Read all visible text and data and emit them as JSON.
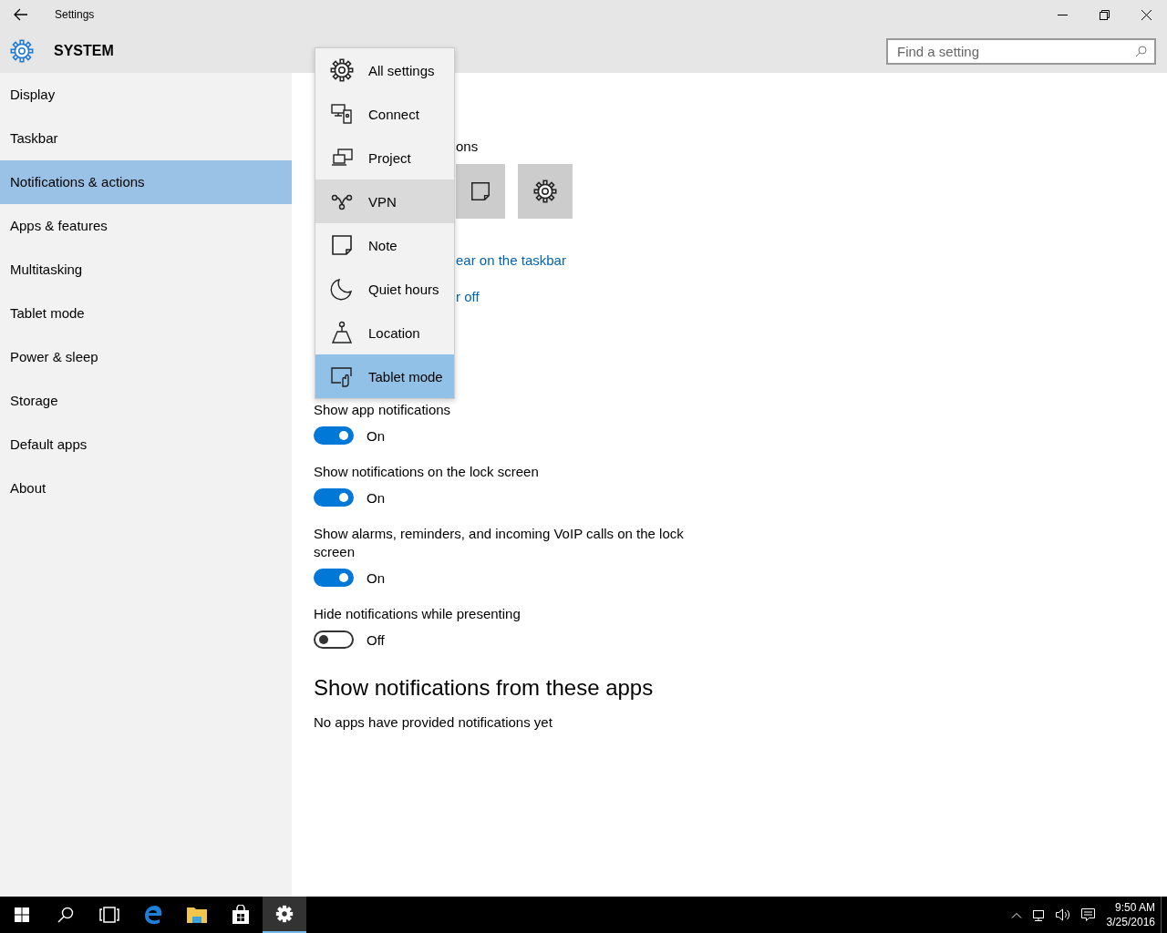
{
  "window": {
    "title": "Settings"
  },
  "header": {
    "title": "SYSTEM"
  },
  "search": {
    "placeholder": "Find a setting"
  },
  "sidebar": {
    "items": [
      {
        "label": "Display",
        "selected": false
      },
      {
        "label": "Taskbar",
        "selected": false
      },
      {
        "label": "Notifications & actions",
        "selected": true
      },
      {
        "label": "Apps & features",
        "selected": false
      },
      {
        "label": "Multitasking",
        "selected": false
      },
      {
        "label": "Tablet mode",
        "selected": false
      },
      {
        "label": "Power & sleep",
        "selected": false
      },
      {
        "label": "Storage",
        "selected": false
      },
      {
        "label": "Default apps",
        "selected": false
      },
      {
        "label": "About",
        "selected": false
      }
    ]
  },
  "quick_actions": {
    "heading_fragment": "ons",
    "tiles": [
      {
        "kind": "note"
      },
      {
        "kind": "gear"
      }
    ],
    "links": [
      "ear on the taskbar",
      "r off"
    ]
  },
  "menu": {
    "items": [
      {
        "label": "All settings",
        "kind": "gear",
        "hovered": false,
        "selected": false
      },
      {
        "label": "Connect",
        "kind": "connect",
        "hovered": false,
        "selected": false
      },
      {
        "label": "Project",
        "kind": "project",
        "hovered": false,
        "selected": false
      },
      {
        "label": "VPN",
        "kind": "vpn",
        "hovered": true,
        "selected": false
      },
      {
        "label": "Note",
        "kind": "note",
        "hovered": false,
        "selected": false
      },
      {
        "label": "Quiet hours",
        "kind": "moon",
        "hovered": false,
        "selected": false
      },
      {
        "label": "Location",
        "kind": "location",
        "hovered": false,
        "selected": false
      },
      {
        "label": "Tablet mode",
        "kind": "tablet",
        "hovered": false,
        "selected": true
      }
    ]
  },
  "toggles": [
    {
      "label": "Show app notifications",
      "on": true,
      "state_text": "On"
    },
    {
      "label": "Show notifications on the lock screen",
      "on": true,
      "state_text": "On"
    },
    {
      "label": "Show alarms, reminders, and incoming VoIP calls on the lock screen",
      "on": true,
      "state_text": "On"
    },
    {
      "label": "Hide notifications while presenting",
      "on": false,
      "state_text": "Off"
    }
  ],
  "apps_section": {
    "title": "Show notifications from these apps",
    "empty_text": "No apps have provided notifications yet"
  },
  "taskbar": {
    "apps": [
      {
        "kind": "start",
        "active": false
      },
      {
        "kind": "search",
        "active": false
      },
      {
        "kind": "taskview",
        "active": false
      },
      {
        "kind": "edge",
        "active": false
      },
      {
        "kind": "explorer",
        "active": false
      },
      {
        "kind": "store",
        "active": false
      },
      {
        "kind": "settings",
        "active": true
      }
    ],
    "clock": {
      "time": "9:50 AM",
      "date": "3/25/2016"
    }
  }
}
